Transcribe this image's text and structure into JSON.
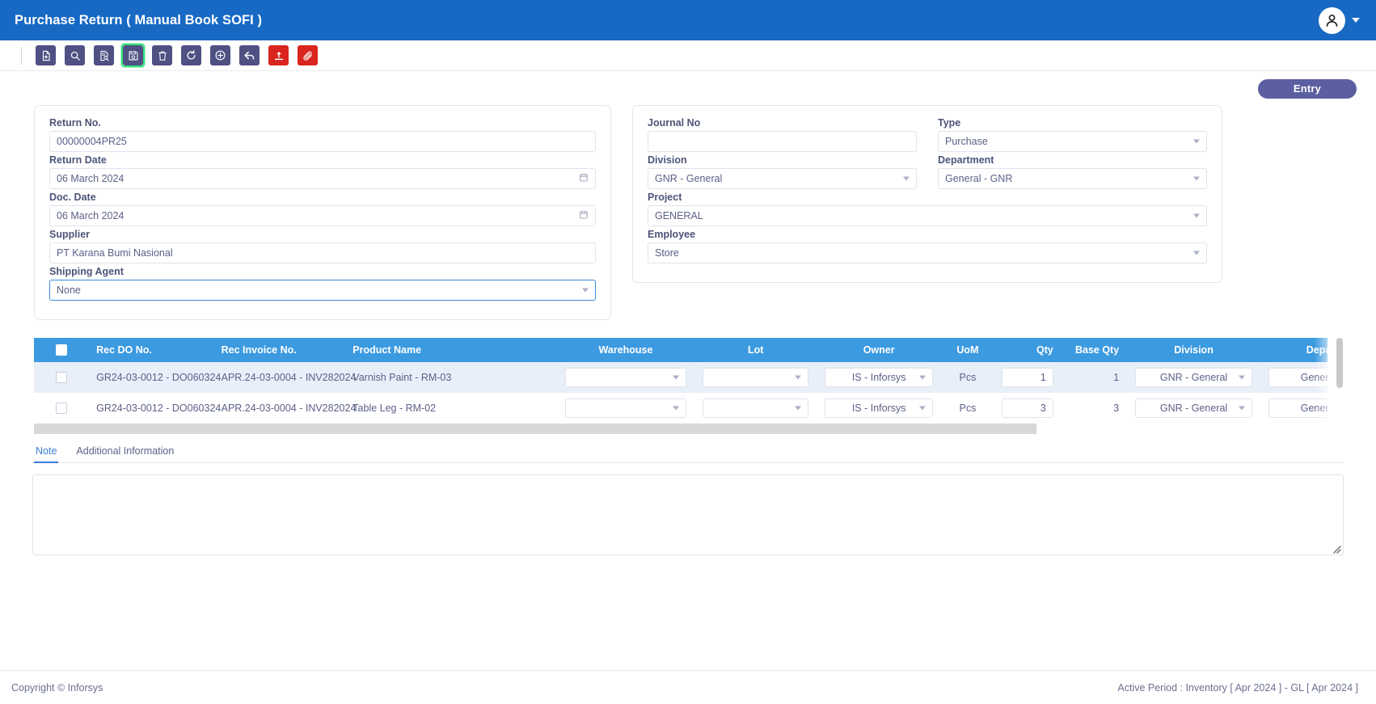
{
  "window": {
    "title": "Purchase Return ( Manual Book SOFI )",
    "accent_blue": "#1769c3",
    "toolbar_button_color": "#4f5183",
    "toolbar_danger_color": "#d9251d",
    "highlight_color": "#33e07a",
    "table_header_color": "#3c9ae0",
    "entry_button_color": "#5b5ea0"
  },
  "user_menu": {
    "avatar_icon": "user-icon",
    "caret_icon": "chevron-down-icon"
  },
  "toolbar": {
    "buttons": [
      {
        "name": "new-document-button",
        "icon": "file-plus-icon",
        "style": "primary",
        "highlighted": false
      },
      {
        "name": "search-button",
        "icon": "search-icon",
        "style": "primary",
        "highlighted": false
      },
      {
        "name": "browse-document-button",
        "icon": "file-search-icon",
        "style": "primary",
        "highlighted": false
      },
      {
        "name": "save-button",
        "icon": "save-floppy-icon",
        "style": "primary",
        "highlighted": true
      },
      {
        "name": "delete-button",
        "icon": "trash-icon",
        "style": "primary",
        "highlighted": false
      },
      {
        "name": "refresh-button",
        "icon": "refresh-icon",
        "style": "primary",
        "highlighted": false
      },
      {
        "name": "add-circle-button",
        "icon": "plus-circle-icon",
        "style": "primary",
        "highlighted": false
      },
      {
        "name": "back-button",
        "icon": "arrow-back-icon",
        "style": "primary",
        "highlighted": false
      },
      {
        "name": "upload-button",
        "icon": "upload-icon",
        "style": "danger",
        "highlighted": false
      },
      {
        "name": "attachment-button",
        "icon": "paperclip-icon",
        "style": "danger",
        "highlighted": false
      }
    ]
  },
  "entry": {
    "label": "Entry"
  },
  "form_left": {
    "return_no": {
      "label": "Return No.",
      "value": "00000004PR25"
    },
    "return_date": {
      "label": "Return Date",
      "value": "06 March 2024",
      "icon": "calendar-icon"
    },
    "doc_date": {
      "label": "Doc. Date",
      "value": "06 March 2024",
      "icon": "calendar-icon"
    },
    "supplier": {
      "label": "Supplier",
      "value": "PT Karana Bumi Nasional"
    },
    "shipping_agent": {
      "label": "Shipping Agent",
      "value": "None",
      "icon": "chevron-down-icon"
    }
  },
  "form_right": {
    "journal_no": {
      "label": "Journal No",
      "value": ""
    },
    "type": {
      "label": "Type",
      "value": "Purchase",
      "icon": "chevron-down-icon"
    },
    "division": {
      "label": "Division",
      "value": "GNR - General",
      "icon": "chevron-down-icon"
    },
    "department": {
      "label": "Department",
      "value": "General - GNR",
      "icon": "chevron-down-icon"
    },
    "project": {
      "label": "Project",
      "value": "GENERAL",
      "icon": "chevron-down-icon"
    },
    "employee": {
      "label": "Employee",
      "value": "Store",
      "icon": "chevron-down-icon"
    }
  },
  "grid": {
    "columns": [
      {
        "key": "select",
        "label": "",
        "align": "center"
      },
      {
        "key": "rec_do_no",
        "label": "Rec DO No.",
        "align": "left"
      },
      {
        "key": "rec_invoice_no",
        "label": "Rec Invoice No.",
        "align": "left"
      },
      {
        "key": "product_name",
        "label": "Product Name",
        "align": "left"
      },
      {
        "key": "warehouse",
        "label": "Warehouse",
        "align": "center"
      },
      {
        "key": "lot",
        "label": "Lot",
        "align": "center"
      },
      {
        "key": "owner",
        "label": "Owner",
        "align": "center"
      },
      {
        "key": "uom",
        "label": "UoM",
        "align": "center"
      },
      {
        "key": "qty",
        "label": "Qty",
        "align": "right"
      },
      {
        "key": "base_qty",
        "label": "Base Qty",
        "align": "right"
      },
      {
        "key": "division",
        "label": "Division",
        "align": "center"
      },
      {
        "key": "department",
        "label": "Department",
        "align": "center"
      }
    ],
    "rows": [
      {
        "selected": false,
        "rec_do_no": "GR24-03-0012 - DO060324",
        "rec_invoice_no": "APR.24-03-0004 - INV282024",
        "product_name": "Varnish Paint - RM-03",
        "warehouse": "",
        "lot": "",
        "owner": "IS - Inforsys",
        "uom": "Pcs",
        "qty": "1",
        "base_qty": "1",
        "division": "GNR - General",
        "department": "General - GNR"
      },
      {
        "selected": false,
        "rec_do_no": "GR24-03-0012 - DO060324",
        "rec_invoice_no": "APR.24-03-0004 - INV282024",
        "product_name": "Table Leg - RM-02",
        "warehouse": "",
        "lot": "",
        "owner": "IS - Inforsys",
        "uom": "Pcs",
        "qty": "3",
        "base_qty": "3",
        "division": "GNR - General",
        "department": "General - GNR"
      }
    ]
  },
  "tabs": [
    {
      "label": "Note",
      "active": true
    },
    {
      "label": "Additional Information",
      "active": false
    }
  ],
  "note": {
    "value": "",
    "placeholder": ""
  },
  "footer": {
    "copyright": "Copyright © Inforsys",
    "active_period": "Active Period : Inventory [ Apr 2024 ]  -  GL [ Apr 2024 ]"
  }
}
